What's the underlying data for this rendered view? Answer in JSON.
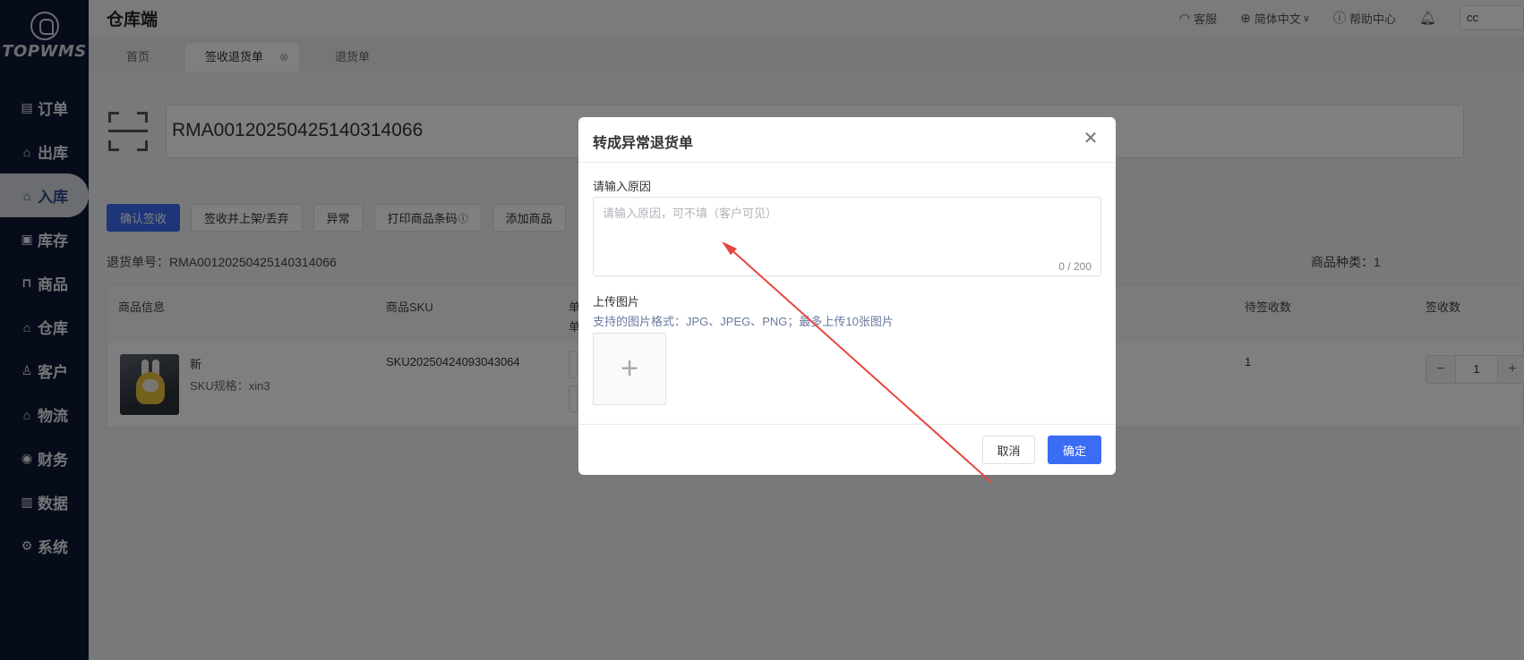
{
  "sidebar": {
    "logo_text": "TOPWMS",
    "items": [
      {
        "label": "订单",
        "icon": "order-icon"
      },
      {
        "label": "出库",
        "icon": "outbound-icon"
      },
      {
        "label": "入库",
        "icon": "inbound-icon",
        "active": true
      },
      {
        "label": "库存",
        "icon": "inventory-icon"
      },
      {
        "label": "商品",
        "icon": "product-icon"
      },
      {
        "label": "仓库",
        "icon": "warehouse-icon"
      },
      {
        "label": "客户",
        "icon": "customer-icon"
      },
      {
        "label": "物流",
        "icon": "logistics-icon"
      },
      {
        "label": "财务",
        "icon": "finance-icon"
      },
      {
        "label": "数据",
        "icon": "data-icon"
      },
      {
        "label": "系统",
        "icon": "settings-icon"
      }
    ]
  },
  "header": {
    "title": "仓库端",
    "service": "客服",
    "language": "简体中文",
    "help": "帮助中心",
    "user": "cc"
  },
  "tabs": [
    {
      "label": "首页"
    },
    {
      "label": "签收退货单",
      "active": true
    },
    {
      "label": "退货单"
    }
  ],
  "scan": {
    "value": "RMA00120250425140314066"
  },
  "actions": {
    "confirm": "确认签收",
    "shelve_discard": "签收并上架/丢弃",
    "abnormal": "异常",
    "print_barcode": "打印商品条码",
    "add_product": "添加商品"
  },
  "meta": {
    "return_no": "退货单号：RMA00120250425140314066",
    "kinds": "商品种类：1"
  },
  "table": {
    "headers": {
      "product_info": "商品信息",
      "sku": "商品SKU",
      "col3": "单",
      "col3b": "单",
      "pending": "待签收数",
      "signed": "签收数"
    },
    "rows": [
      {
        "name": "新",
        "spec": "SKU规格：xin3",
        "sku": "SKU20250424093043064",
        "pending": "1",
        "signed": "1"
      }
    ]
  },
  "modal": {
    "title": "转成异常退货单",
    "reason_label": "请输入原因",
    "reason_placeholder": "请输入原因，可不填（客户可见）",
    "counter": "0 / 200",
    "upload_label": "上传图片",
    "upload_hint": "支持的图片格式：JPG、JPEG、PNG；最多上传10张图片",
    "cancel": "取消",
    "ok": "确定"
  },
  "colors": {
    "primary": "#3a6cf4",
    "sidebar": "#0f1936",
    "annotation_arrow": "#e8453c"
  }
}
